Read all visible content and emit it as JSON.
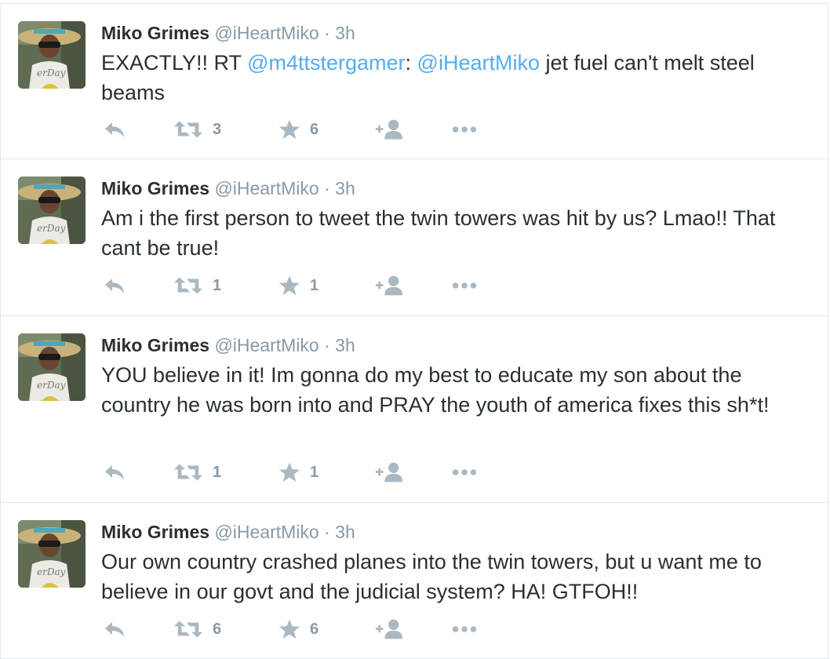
{
  "tweets": [
    {
      "name": "Miko Grimes",
      "handle": "@iHeartMiko",
      "sep": "·",
      "time": "3h",
      "text_parts": [
        "EXACTLY!! RT ",
        "@m4ttstergamer",
        ": ",
        "@iHeartMiko",
        " jet fuel can't melt steel beams"
      ],
      "retweets": "3",
      "favorites": "6"
    },
    {
      "name": "Miko Grimes",
      "handle": "@iHeartMiko",
      "sep": "·",
      "time": "3h",
      "text": "Am i the first person to tweet the twin towers was hit by us? Lmao!! That cant be true!",
      "retweets": "1",
      "favorites": "1"
    },
    {
      "name": "Miko Grimes",
      "handle": "@iHeartMiko",
      "sep": "·",
      "time": "3h",
      "text": "YOU believe in it! Im gonna do my best to educate my son about the country he was born into and PRAY the youth of america fixes this sh*t!",
      "retweets": "1",
      "favorites": "1"
    },
    {
      "name": "Miko Grimes",
      "handle": "@iHeartMiko",
      "sep": "·",
      "time": "3h",
      "text": "Our own country crashed planes into the twin towers, but u want me to believe in our govt and the judicial system? HA! GTFOH!!",
      "retweets": "6",
      "favorites": "6"
    }
  ],
  "avatar_lettering": "erDay",
  "icons": [
    "reply-icon",
    "retweet-icon",
    "favorite-icon",
    "follow-icon",
    "more-icon"
  ],
  "colors": {
    "mention": "#55acee",
    "name": "#292f33",
    "meta": "#8899a6",
    "action": "#aab8c2",
    "border": "#e1e8ed"
  }
}
